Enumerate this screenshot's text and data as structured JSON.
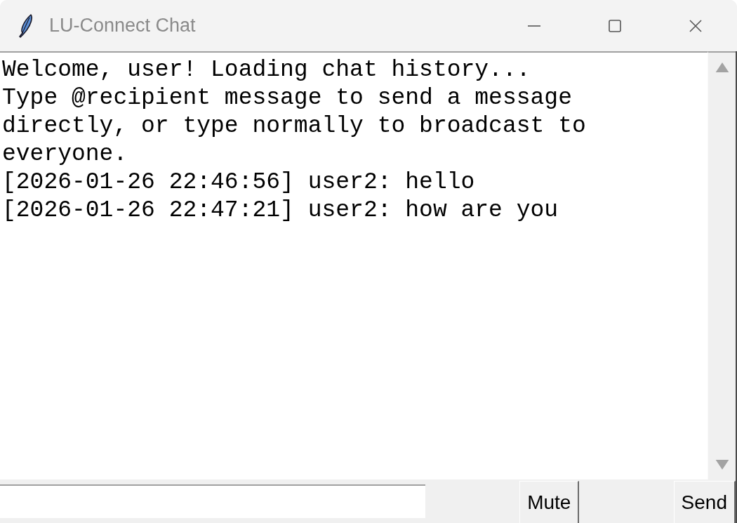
{
  "window": {
    "title": "LU-Connect Chat"
  },
  "chat_log": {
    "lines": [
      "Welcome, user! Loading chat history...",
      "Type @recipient message to send a message directly, or type normally to broadcast to everyone.",
      "[2026-01-26 22:46:56] user2: hello",
      "[2026-01-26 22:47:21] user2: how are you"
    ]
  },
  "buttons": [
    "Mute",
    "Send"
  ]
}
